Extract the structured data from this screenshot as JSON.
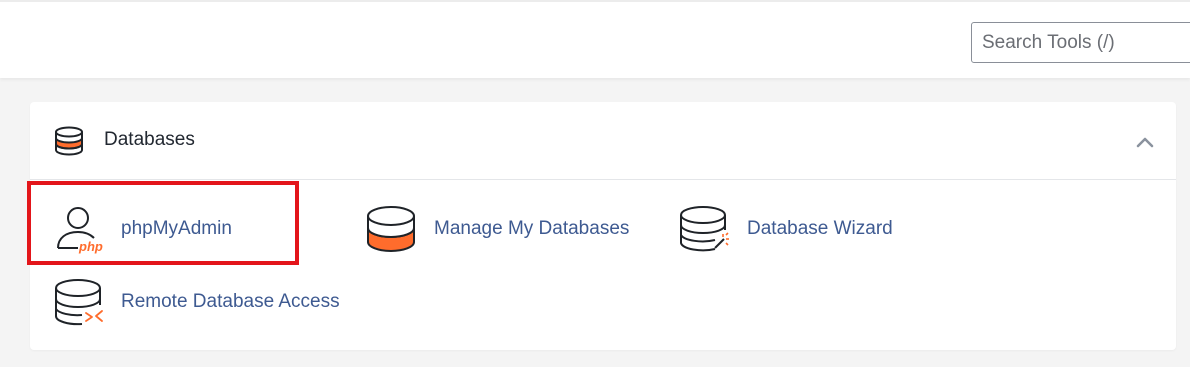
{
  "search": {
    "placeholder": "Search Tools (/)",
    "value": ""
  },
  "section": {
    "title": "Databases",
    "icon": "database-stack-icon",
    "toggle_icon": "chevron-up-icon",
    "expanded": true
  },
  "tools": [
    {
      "label": "phpMyAdmin",
      "icon": "phpmyadmin-user-icon",
      "icon_text": "php"
    },
    {
      "label": "Manage My Databases",
      "icon": "database-icon"
    },
    {
      "label": "Database Wizard",
      "icon": "database-wizard-icon"
    },
    {
      "label": "Remote Database Access",
      "icon": "remote-database-icon"
    }
  ],
  "colors": {
    "accent": "#ff6c2c",
    "link": "#3e5a91",
    "highlight": "#e3151a",
    "icon_stroke": "#1f2328"
  }
}
